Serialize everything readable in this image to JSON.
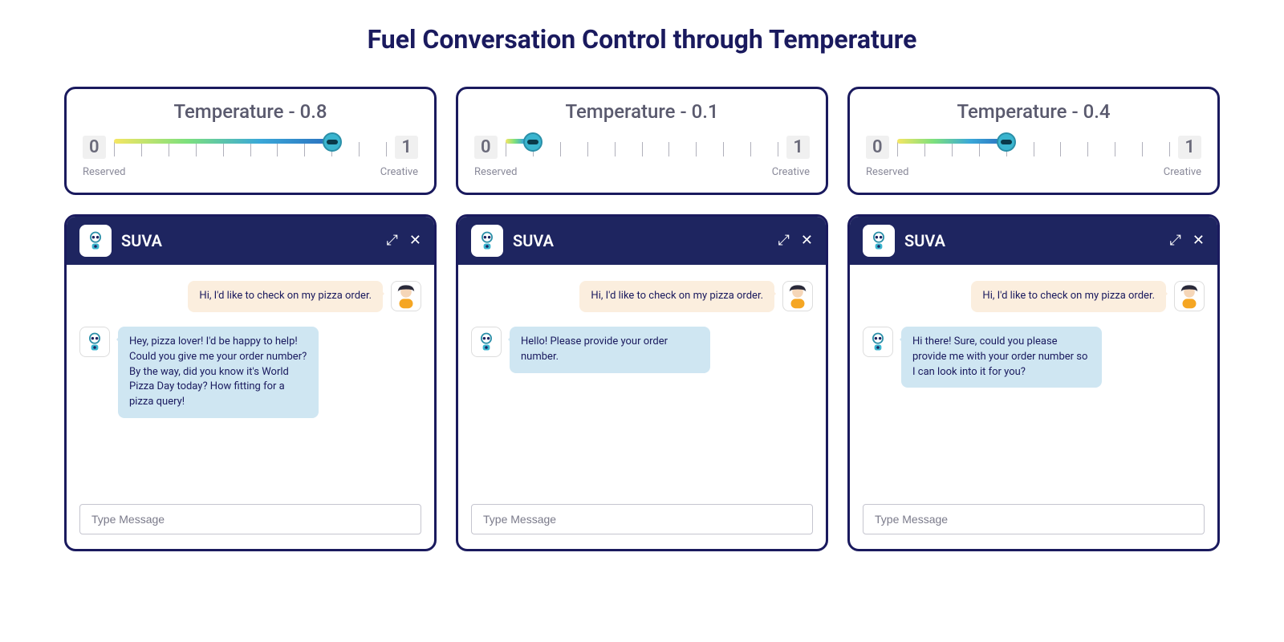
{
  "title": "Fuel Conversation Control through Temperature",
  "slider": {
    "min_label": "0",
    "max_label": "1",
    "left_text": "Reserved",
    "right_text": "Creative"
  },
  "panels": [
    {
      "temp_label": "Temperature - 0.8",
      "temp_value": 0.8,
      "chat_title": "SUVA",
      "user_msg": "Hi, I'd like to check on my pizza order.",
      "bot_msg": "Hey, pizza lover! I'd be happy to help! Could you give me your order number? By the way, did you know it's World Pizza Day today? How fitting for a pizza query!",
      "input_placeholder": "Type Message"
    },
    {
      "temp_label": "Temperature - 0.1",
      "temp_value": 0.1,
      "chat_title": "SUVA",
      "user_msg": "Hi, I'd like to check on my pizza order.",
      "bot_msg": "Hello! Please provide your order number.",
      "input_placeholder": "Type Message"
    },
    {
      "temp_label": "Temperature - 0.4",
      "temp_value": 0.4,
      "chat_title": "SUVA",
      "user_msg": "Hi, I'd like to check on my pizza order.",
      "bot_msg": "Hi there! Sure, could you please provide me with your order number so I can look into it for you?",
      "input_placeholder": "Type Message"
    }
  ]
}
